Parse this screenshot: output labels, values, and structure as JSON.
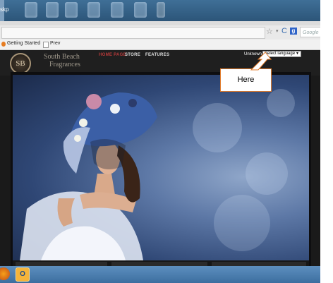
{
  "desktop_strip": {
    "partial_text": "skp"
  },
  "browser": {
    "search_placeholder": "Google",
    "google_icon_label": "g",
    "bookmarks": [
      {
        "label": "Getting Started"
      },
      {
        "label": "Prev"
      }
    ]
  },
  "site": {
    "logo_text": "SB",
    "brand_line1": "South Beach",
    "brand_line2": "Fragrances",
    "nav": [
      "HOME PAGE",
      "STORE",
      "FEATURES"
    ],
    "language_label": "Unknown",
    "language_select": "Select language"
  },
  "callout": {
    "text": "Here"
  },
  "colors": {
    "accent_nav": "#b73a3a",
    "callout_border": "#e07b2b",
    "taskbar": "#4a7cad"
  },
  "taskbar": {
    "outlook_label": "O"
  }
}
